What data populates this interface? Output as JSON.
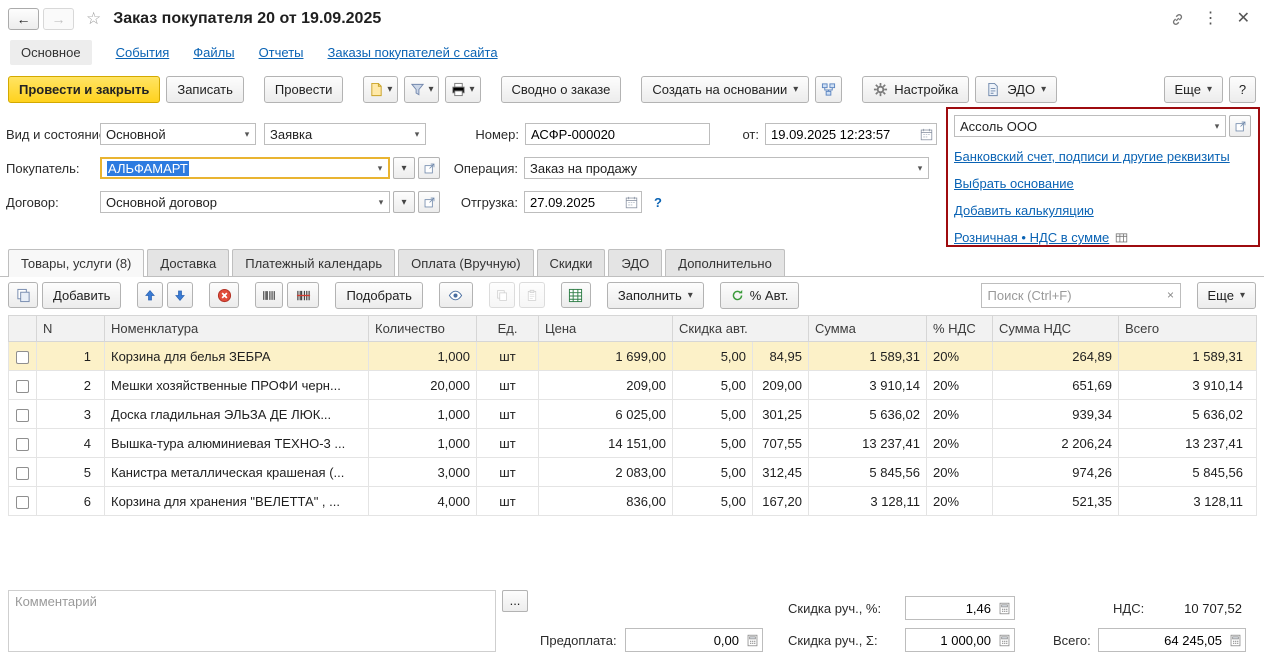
{
  "icons": {
    "back": "←",
    "forward": "→",
    "star": "☆",
    "menu": "⋮",
    "close": "✕",
    "dropdown": "▾",
    "ellipsis": "...",
    "clear": "×"
  },
  "window": {
    "title": "Заказ покупателя 20 от 19.09.2025"
  },
  "section_tabs": [
    {
      "label": "Основное"
    },
    {
      "label": "События"
    },
    {
      "label": "Файлы"
    },
    {
      "label": "Отчеты"
    },
    {
      "label": "Заказы покупателей с сайта"
    }
  ],
  "toolbar": {
    "post_and_close": "Провести и закрыть",
    "write": "Записать",
    "post": "Провести",
    "order_summary": "Сводно о заказе",
    "create_from": "Создать на основании",
    "settings": "Настройка",
    "edo": "ЭДО",
    "more": "Еще",
    "help": "?"
  },
  "form": {
    "kind_label": "Вид и состояние:",
    "kind_value": "Основной",
    "status_value": "Заявка",
    "number_label": "Номер:",
    "number_value": "АСФР-000020",
    "date_label": "от:",
    "date_value": "19.09.2025 12:23:57",
    "customer_label": "Покупатель:",
    "customer_value": "АЛЬФАМАРТ",
    "operation_label": "Операция:",
    "operation_value": "Заказ на продажу",
    "contract_label": "Договор:",
    "contract_value": "Основной договор",
    "shipment_label": "Отгрузка:",
    "shipment_value": "27.09.2025",
    "shipment_hint": "?",
    "organization_value": "Ассоль ООО",
    "links": [
      {
        "label": "Банковский счет, подписи и другие реквизиты"
      },
      {
        "label": "Выбрать основание"
      },
      {
        "label": "Добавить калькуляцию"
      },
      {
        "label": "Розничная • НДС в сумме"
      }
    ]
  },
  "doc_tabs": [
    {
      "label": "Товары, услуги (8)"
    },
    {
      "label": "Доставка"
    },
    {
      "label": "Платежный календарь"
    },
    {
      "label": "Оплата (Вручную)"
    },
    {
      "label": "Скидки"
    },
    {
      "label": "ЭДО"
    },
    {
      "label": "Дополнительно"
    }
  ],
  "table_toolbar": {
    "add": "Добавить",
    "pick": "Подобрать",
    "fill": "Заполнить",
    "auto_percent": "% Авт.",
    "search_placeholder": "Поиск (Ctrl+F)",
    "more": "Еще"
  },
  "table": {
    "columns": [
      "N",
      "Номенклатура",
      "Количество",
      "Ед.",
      "Цена",
      "Скидка авт.",
      "Сумма",
      "% НДС",
      "Сумма НДС",
      "Всего"
    ],
    "rows": [
      {
        "n": "1",
        "name": "Корзина для белья ЗЕБРА",
        "qty": "1,000",
        "unit": "шт",
        "price": "1 699,00",
        "disc_pct": "5,00",
        "disc_sum": "84,95",
        "amount": "1 589,31",
        "vat": "20%",
        "vat_sum": "264,89",
        "total": "1 589,31"
      },
      {
        "n": "2",
        "name": "Мешки хозяйственные ПРОФИ черн...",
        "qty": "20,000",
        "unit": "шт",
        "price": "209,00",
        "disc_pct": "5,00",
        "disc_sum": "209,00",
        "amount": "3 910,14",
        "vat": "20%",
        "vat_sum": "651,69",
        "total": "3 910,14"
      },
      {
        "n": "3",
        "name": "Доска гладильная  ЭЛЬЗА ДЕ ЛЮК...",
        "qty": "1,000",
        "unit": "шт",
        "price": "6 025,00",
        "disc_pct": "5,00",
        "disc_sum": "301,25",
        "amount": "5 636,02",
        "vat": "20%",
        "vat_sum": "939,34",
        "total": "5 636,02"
      },
      {
        "n": "4",
        "name": "Вышка-тура алюминиевая ТЕХНО-3 ...",
        "qty": "1,000",
        "unit": "шт",
        "price": "14 151,00",
        "disc_pct": "5,00",
        "disc_sum": "707,55",
        "amount": "13 237,41",
        "vat": "20%",
        "vat_sum": "2 206,24",
        "total": "13 237,41"
      },
      {
        "n": "5",
        "name": "Канистра металлическая крашеная (...",
        "qty": "3,000",
        "unit": "шт",
        "price": "2 083,00",
        "disc_pct": "5,00",
        "disc_sum": "312,45",
        "amount": "5 845,56",
        "vat": "20%",
        "vat_sum": "974,26",
        "total": "5 845,56"
      },
      {
        "n": "6",
        "name": "Корзина для хранения \"ВЕЛЕТТА\" , ...",
        "qty": "4,000",
        "unit": "шт",
        "price": "836,00",
        "disc_pct": "5,00",
        "disc_sum": "167,20",
        "amount": "3 128,11",
        "vat": "20%",
        "vat_sum": "521,35",
        "total": "3 128,11"
      }
    ]
  },
  "footer": {
    "comment_placeholder": "Комментарий",
    "prepayment_label": "Предоплата:",
    "prepayment_value": "0,00",
    "manual_discount_pct_label": "Скидка руч., %:",
    "manual_discount_pct_value": "1,46",
    "vat_label": "НДС:",
    "vat_value": "10 707,52",
    "manual_discount_sum_label": "Скидка руч., Σ:",
    "manual_discount_sum_value": "1 000,00",
    "total_label": "Всего:",
    "total_value": "64 245,05"
  }
}
